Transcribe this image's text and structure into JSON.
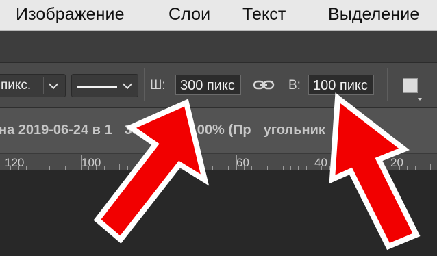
{
  "menubar": {
    "items": [
      "Изображение",
      "Слои",
      "Текст",
      "Выделение"
    ]
  },
  "options": {
    "unit_dropdown": "пикс.",
    "width_label": "Ш:",
    "width_value": "300 пикс",
    "height_label": "В:",
    "height_value": "100 пикс"
  },
  "document": {
    "tab_title": "на 2019-06-24 в 1",
    "tab_title_rest": "38.png @ 100% (Пр",
    "tab_title_end": "угольник"
  },
  "ruler": {
    "labels": [
      "120",
      "100",
      "60",
      "40",
      "20"
    ]
  },
  "colors": {
    "arrow_fill": "#f20000",
    "arrow_outline": "#ffffff"
  }
}
